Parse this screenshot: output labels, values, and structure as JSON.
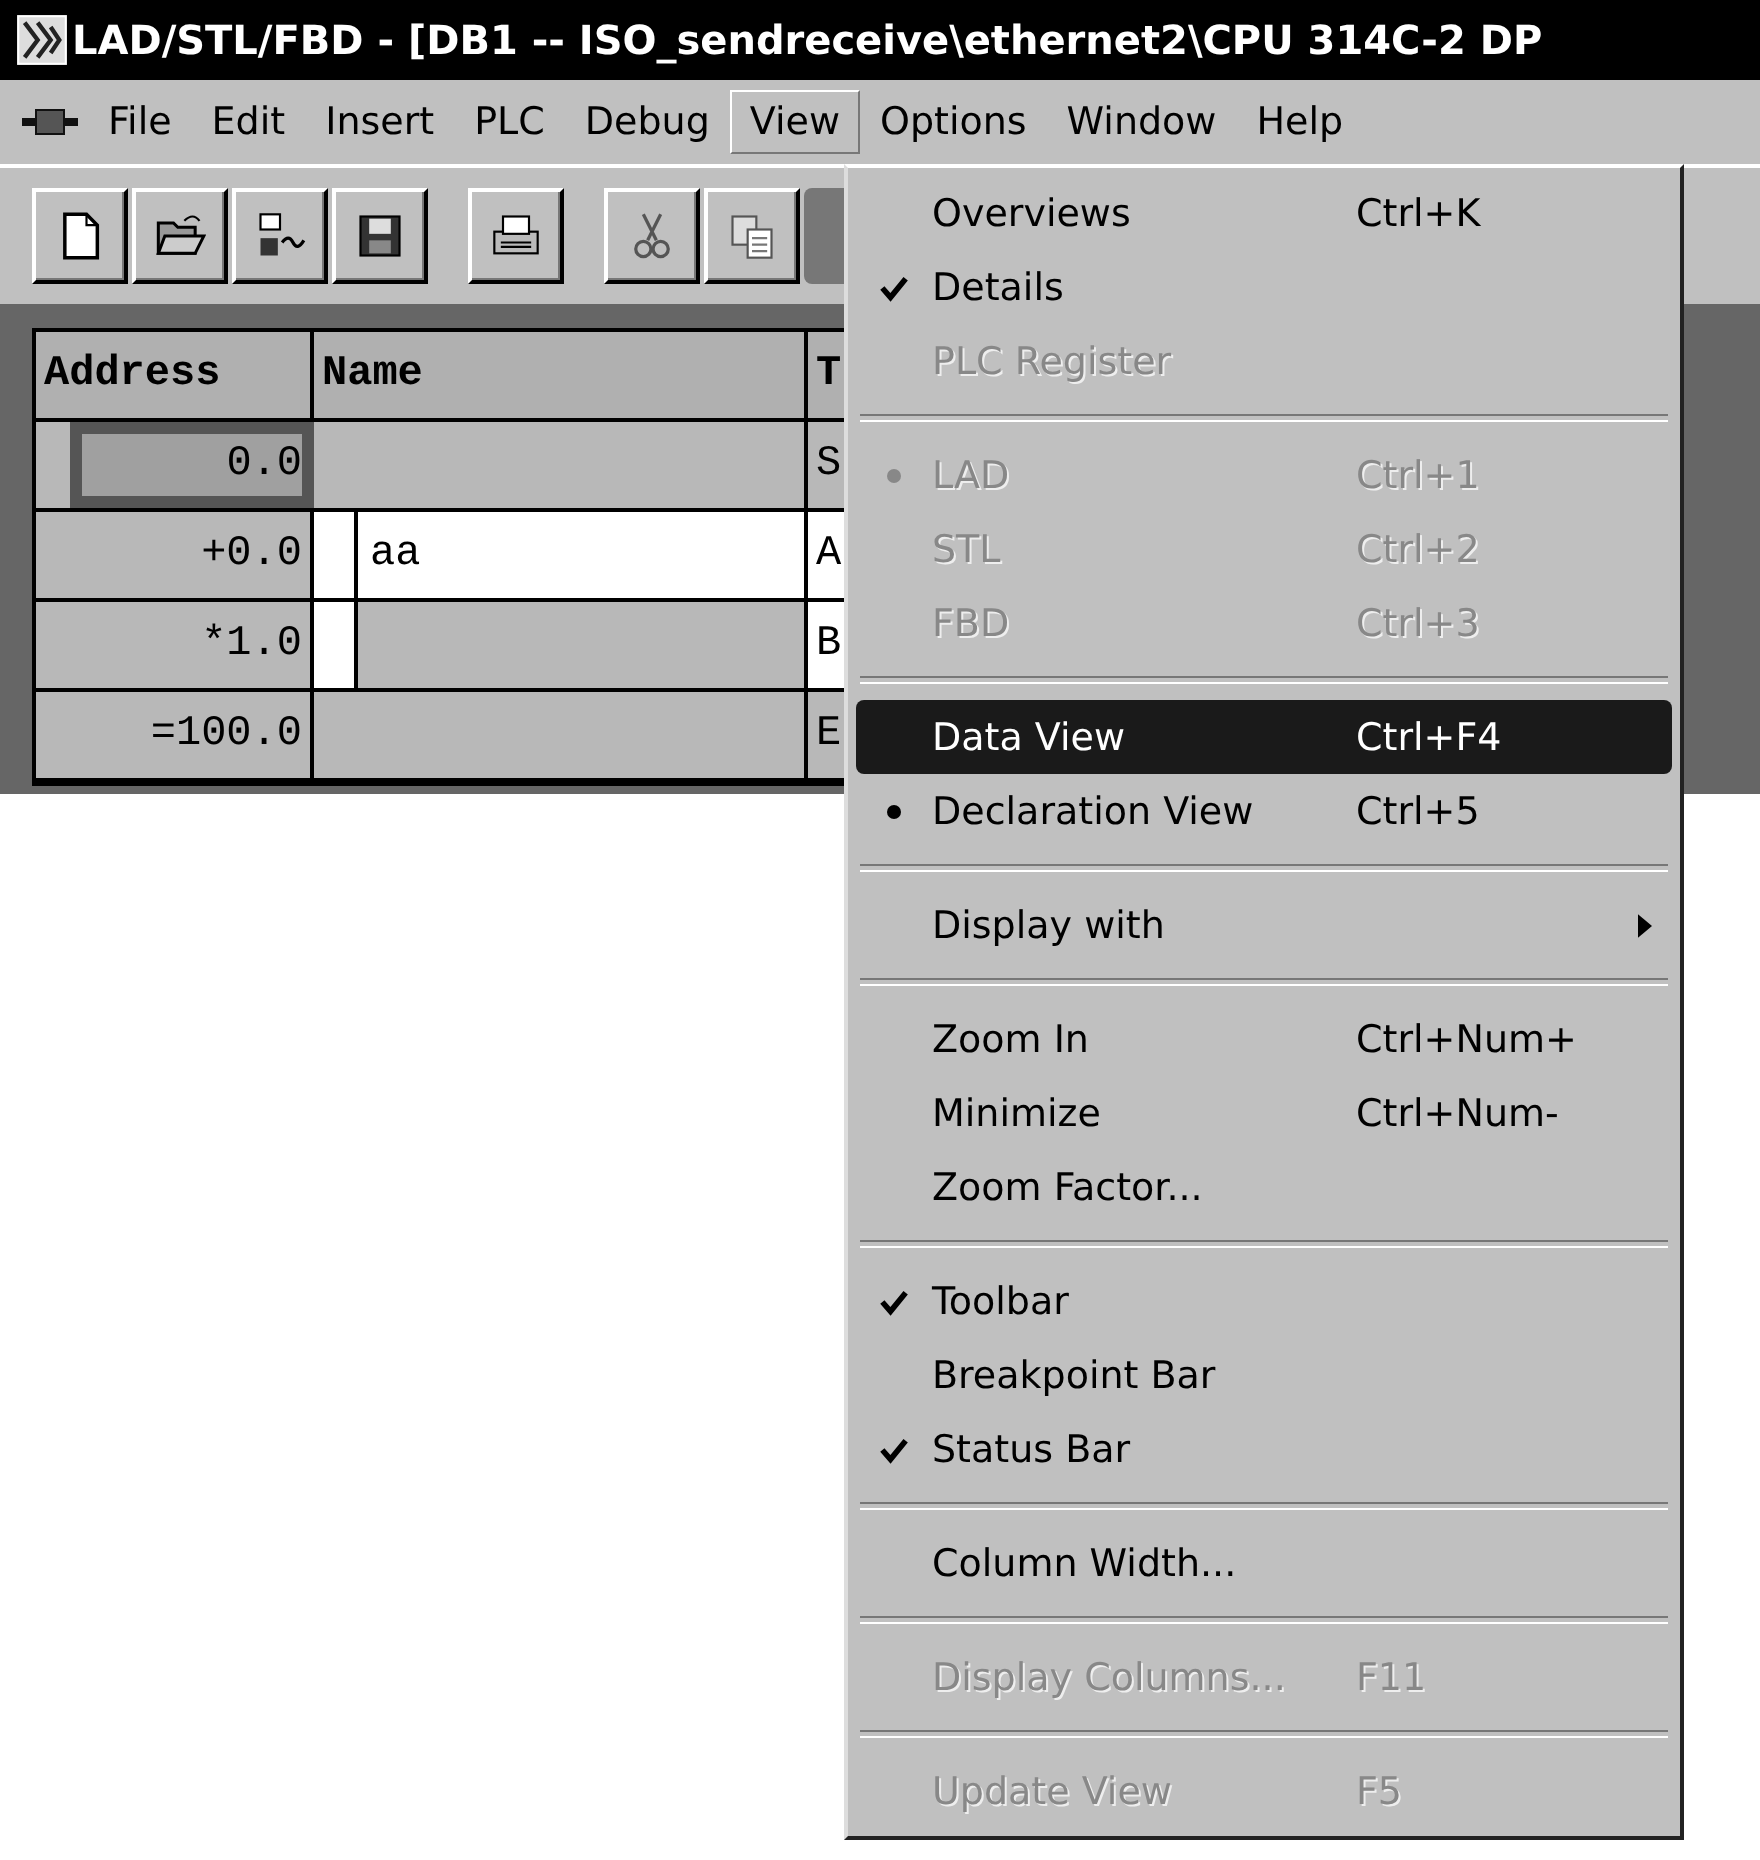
{
  "window": {
    "title": "LAD/STL/FBD  - [DB1 -- ISO_sendreceive\\ethernet2\\CPU 314C-2 DP"
  },
  "menubar": [
    {
      "label": "File",
      "selected": false
    },
    {
      "label": "Edit",
      "selected": false
    },
    {
      "label": "Insert",
      "selected": false
    },
    {
      "label": "PLC",
      "selected": false
    },
    {
      "label": "Debug",
      "selected": false
    },
    {
      "label": "View",
      "selected": true
    },
    {
      "label": "Options",
      "selected": false
    },
    {
      "label": "Window",
      "selected": false
    },
    {
      "label": "Help",
      "selected": false
    }
  ],
  "toolbar": [
    {
      "kind": "new"
    },
    {
      "kind": "open"
    },
    {
      "kind": "network"
    },
    {
      "kind": "save"
    },
    {
      "kind": "gap"
    },
    {
      "kind": "print"
    },
    {
      "kind": "gap"
    },
    {
      "kind": "cut"
    },
    {
      "kind": "copy"
    },
    {
      "kind": "hidden"
    }
  ],
  "table": {
    "columns": [
      "Address",
      "Name",
      "T"
    ],
    "rows": [
      {
        "address": "0.0",
        "name": "",
        "column_3": "S",
        "selected": true,
        "nested": false
      },
      {
        "address": "+0.0",
        "name": "aa",
        "column_3": "A",
        "selected": false,
        "nested": true
      },
      {
        "address": "*1.0",
        "name": "",
        "column_3": "B",
        "selected": false,
        "nested": true
      },
      {
        "address": "=100.0",
        "name": "",
        "column_3": "E",
        "selected": false,
        "nested": false
      }
    ]
  },
  "view_menu": [
    {
      "kind": "item",
      "label": "Overviews",
      "shortcut": "Ctrl+K",
      "checked": false,
      "radio": false,
      "disabled": false,
      "selected": false
    },
    {
      "kind": "item",
      "label": "Details",
      "checked": true,
      "radio": false,
      "disabled": false,
      "selected": false
    },
    {
      "kind": "item",
      "label": "PLC Register",
      "checked": false,
      "radio": false,
      "disabled": true,
      "selected": false
    },
    {
      "kind": "separator"
    },
    {
      "kind": "item",
      "label": "LAD",
      "shortcut": "Ctrl+1",
      "checked": false,
      "radio": true,
      "disabled": true,
      "selected": false
    },
    {
      "kind": "item",
      "label": "STL",
      "shortcut": "Ctrl+2",
      "checked": false,
      "radio": false,
      "disabled": true,
      "selected": false
    },
    {
      "kind": "item",
      "label": "FBD",
      "shortcut": "Ctrl+3",
      "checked": false,
      "radio": false,
      "disabled": true,
      "selected": false
    },
    {
      "kind": "separator"
    },
    {
      "kind": "item",
      "label": "Data View",
      "shortcut": "Ctrl+F4",
      "checked": false,
      "radio": false,
      "disabled": false,
      "selected": true
    },
    {
      "kind": "item",
      "label": "Declaration View",
      "shortcut": "Ctrl+5",
      "checked": false,
      "radio": true,
      "disabled": false,
      "selected": false
    },
    {
      "kind": "separator"
    },
    {
      "kind": "submenu",
      "label": "Display with",
      "checked": false,
      "radio": false,
      "disabled": false,
      "selected": false
    },
    {
      "kind": "separator"
    },
    {
      "kind": "item",
      "label": "Zoom In",
      "shortcut": "Ctrl+Num+",
      "checked": false,
      "radio": false,
      "disabled": false,
      "selected": false
    },
    {
      "kind": "item",
      "label": "Minimize",
      "shortcut": "Ctrl+Num-",
      "checked": false,
      "radio": false,
      "disabled": false,
      "selected": false
    },
    {
      "kind": "item",
      "label": "Zoom Factor...",
      "checked": false,
      "radio": false,
      "disabled": false,
      "selected": false
    },
    {
      "kind": "separator"
    },
    {
      "kind": "item",
      "label": "Toolbar",
      "checked": true,
      "radio": false,
      "disabled": false,
      "selected": false
    },
    {
      "kind": "item",
      "label": "Breakpoint Bar",
      "checked": false,
      "radio": false,
      "disabled": false,
      "selected": false
    },
    {
      "kind": "item",
      "label": "Status Bar",
      "checked": true,
      "radio": false,
      "disabled": false,
      "selected": false
    },
    {
      "kind": "separator"
    },
    {
      "kind": "item",
      "label": "Column Width...",
      "checked": false,
      "radio": false,
      "disabled": false,
      "selected": false
    },
    {
      "kind": "separator"
    },
    {
      "kind": "item",
      "label": "Display Columns...",
      "shortcut": "F11",
      "checked": false,
      "radio": false,
      "disabled": true,
      "selected": false
    },
    {
      "kind": "separator"
    },
    {
      "kind": "item",
      "label": "Update View",
      "shortcut": "F5",
      "checked": false,
      "radio": false,
      "disabled": true,
      "selected": false
    }
  ]
}
